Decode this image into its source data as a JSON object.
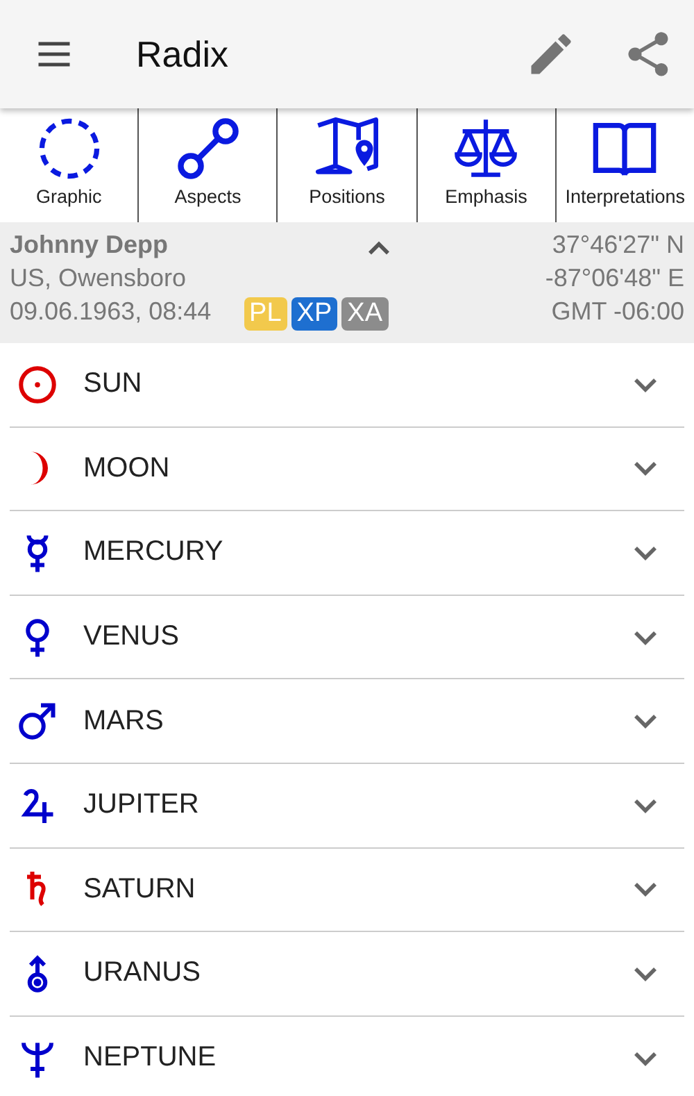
{
  "app_bar": {
    "title": "Radix"
  },
  "tabs": [
    {
      "label": "Graphic"
    },
    {
      "label": "Aspects"
    },
    {
      "label": "Positions"
    },
    {
      "label": "Emphasis"
    },
    {
      "label": "Interpretations"
    }
  ],
  "chart_info": {
    "name": "Johnny Depp",
    "place": "US, Owensboro",
    "datetime": "09.06.1963, 08:44",
    "latitude": "37°46'27\" N",
    "longitude": "-87°06'48\" E",
    "timezone": "GMT -06:00",
    "badges": [
      {
        "label": "PL",
        "color": "#f2c94c"
      },
      {
        "label": "XP",
        "color": "#1e6fd0"
      },
      {
        "label": "XA",
        "color": "#8c8c8c"
      }
    ]
  },
  "planets": [
    {
      "name": "SUN",
      "color": "#dd0000",
      "expanded": false
    },
    {
      "name": "MOON",
      "color": "#dd0000",
      "expanded": false
    },
    {
      "name": "MERCURY",
      "color": "#0000cc",
      "expanded": false
    },
    {
      "name": "VENUS",
      "color": "#0000cc",
      "expanded": false
    },
    {
      "name": "MARS",
      "color": "#0000cc",
      "expanded": false
    },
    {
      "name": "JUPITER",
      "color": "#0000cc",
      "expanded": false
    },
    {
      "name": "SATURN",
      "color": "#dd0000",
      "expanded": false
    },
    {
      "name": "URANUS",
      "color": "#0000cc",
      "expanded": false
    },
    {
      "name": "NEPTUNE",
      "color": "#0000cc",
      "expanded": false
    }
  ]
}
